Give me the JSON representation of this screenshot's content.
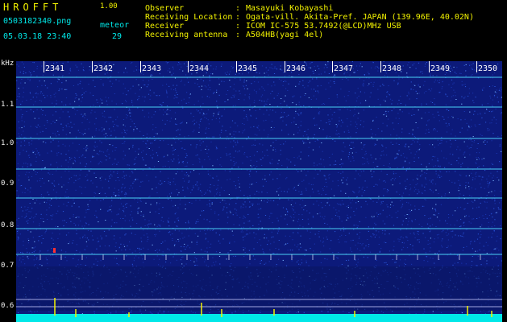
{
  "header": {
    "logo": "HROFFT",
    "version": "1.00",
    "filename": "0503182340.png",
    "datetime": "05.03.18 23:40",
    "meteor_label": "meteor",
    "meteor_count": "29",
    "fields": [
      {
        "label": "Observer",
        "sep": ":",
        "value": "Masayuki Kobayashi"
      },
      {
        "label": "Receiving Location",
        "sep": ":",
        "value": "Ogata-vill. Akita-Pref. JAPAN (139.96E, 40.02N)"
      },
      {
        "label": "Receiver",
        "sep": ":",
        "value": "ICOM IC-575 53.7492(@LCD)MHz USB"
      },
      {
        "label": "Receiving antenna",
        "sep": ":",
        "value": "A504HB(yagi 4el)"
      }
    ]
  },
  "spectrogram": {
    "y_unit": "kHz",
    "y_ticks": [
      "1.1",
      "1.0",
      "0.9",
      "0.8",
      "0.7",
      "0.6"
    ],
    "x_ticks": [
      "2341",
      "2342",
      "2343",
      "2344",
      "2345",
      "2346",
      "2347",
      "2348",
      "2349",
      "2350"
    ],
    "colors": {
      "background": "#0c1a7a",
      "noise": "#2a55d8",
      "band": "#4fe0ff",
      "baseline": "#00e8e8",
      "meteor": "#f2f200"
    }
  }
}
